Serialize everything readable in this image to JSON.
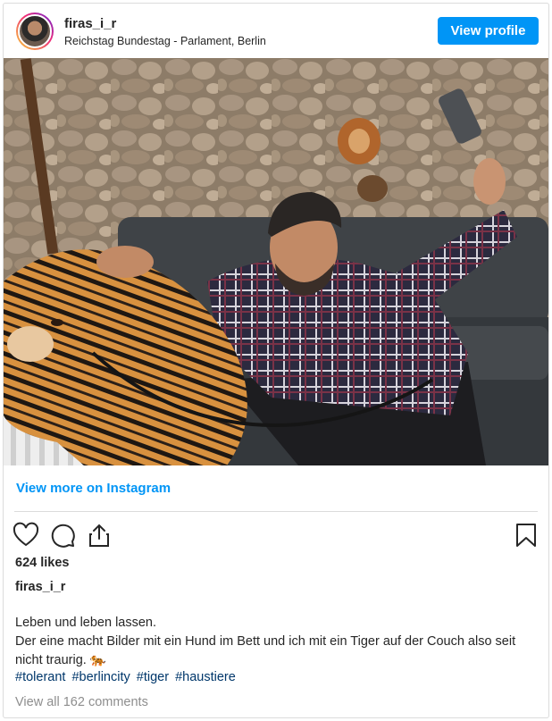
{
  "header": {
    "username": "firas_i_r",
    "location": "Reichstag Bundestag - Parlament, Berlin",
    "view_profile_label": "View profile"
  },
  "post": {
    "view_more_label": "View more on Instagram",
    "likes": "624 likes",
    "caption_user": "firas_i_r",
    "caption_line1": "Leben und leben lassen.",
    "caption_line2": "Der eine macht Bilder mit ein Hund im Bett und ich mit ein Tiger auf der Couch also seit nicht traurig. 🐅",
    "hashtags": [
      "#tolerant",
      "#berlincity",
      "#tiger",
      "#haustiere"
    ],
    "view_comments": "View all 162 comments"
  },
  "icons": {
    "like": "heart-icon",
    "comment": "comment-bubble-icon",
    "share": "share-icon",
    "save": "bookmark-icon"
  },
  "colors": {
    "accent": "#0095f6",
    "hashtag": "#00376b",
    "muted": "#8e8e8e"
  }
}
